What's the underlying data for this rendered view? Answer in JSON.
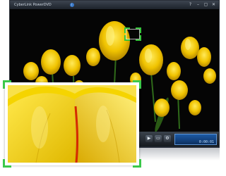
{
  "window": {
    "title": "CyberLink PowerDVD",
    "controls": [
      "?",
      "–",
      "▢",
      "✕"
    ]
  },
  "icons": {
    "info": "info-icon",
    "play": "play-icon",
    "screen": "display-icon",
    "settings": "settings-icon",
    "eject": "eject-icon"
  },
  "status_lcd": {
    "line1": "",
    "time": "0:00:01"
  },
  "colors": {
    "zoom_frame": "#35c43a",
    "lcd_background": "#1c5aa6",
    "tulip": "#f2d300"
  }
}
